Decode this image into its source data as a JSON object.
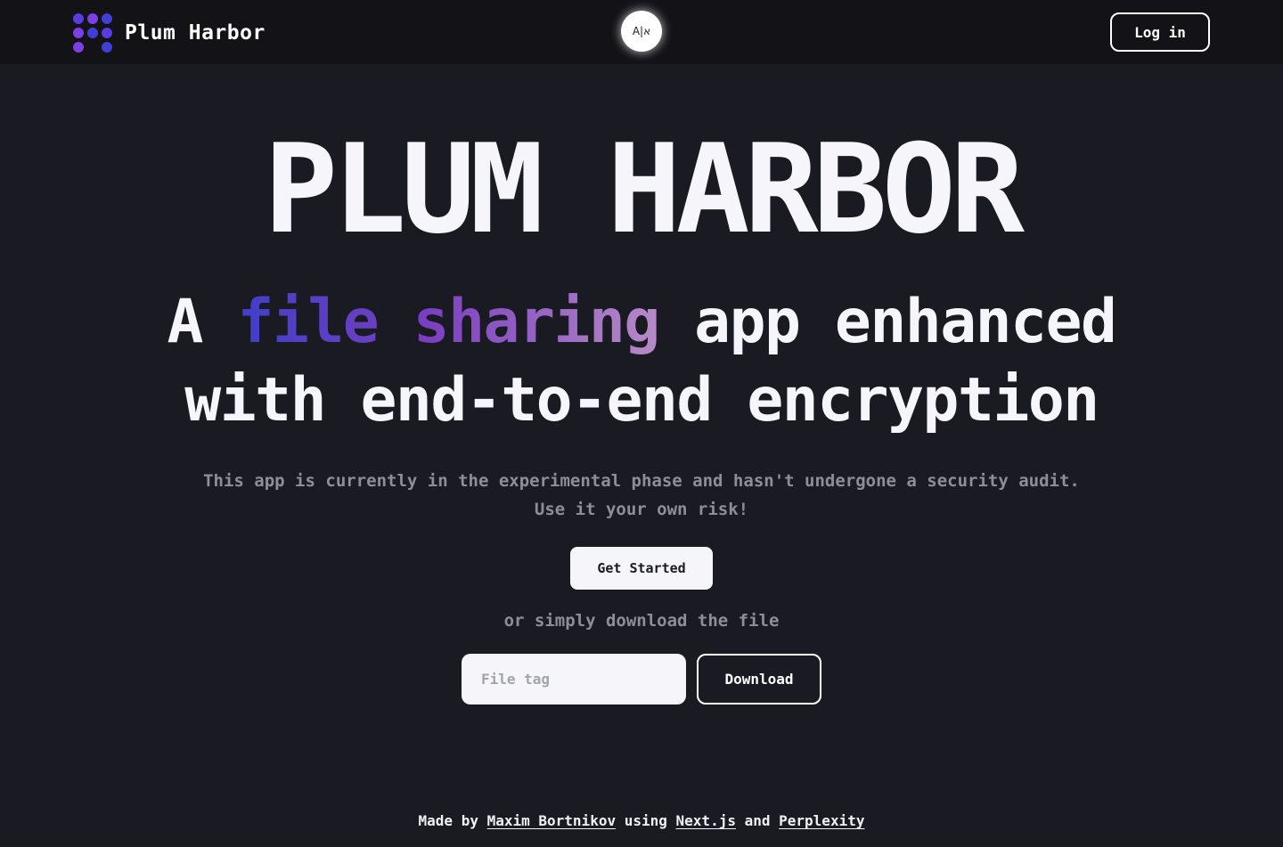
{
  "header": {
    "brand_name": "Plum Harbor",
    "logo_colors": [
      "#7b3fe4",
      "#5b3ae0",
      "#3f3fd6"
    ],
    "lang_toggle_label": "A|א",
    "login_label": "Log in"
  },
  "hero": {
    "title": "PLUM HARBOR",
    "headline_prefix": "A ",
    "headline_highlight": "file sharing",
    "headline_rest": " app enhanced",
    "headline_line2": "with end-to-end encryption",
    "subtext_line1": "This app is currently in the experimental phase and hasn't undergone a security audit.",
    "subtext_line2": "Use it your own risk!",
    "get_started_label": "Get Started",
    "or_text": "or simply download the file",
    "file_tag_placeholder": "File tag",
    "download_label": "Download"
  },
  "footer": {
    "made_by": "Made by ",
    "author": "Maxim Bortnikov",
    "using": " using ",
    "framework": "Next.js",
    "and": " and ",
    "tool": "Perplexity"
  },
  "colors": {
    "background": "#1a1a22",
    "topbar": "#121217",
    "gradient_start": "#3f3fc8",
    "gradient_mid": "#7a3fc0",
    "gradient_end": "#b68bc6",
    "muted_text": "#8e8e96"
  }
}
